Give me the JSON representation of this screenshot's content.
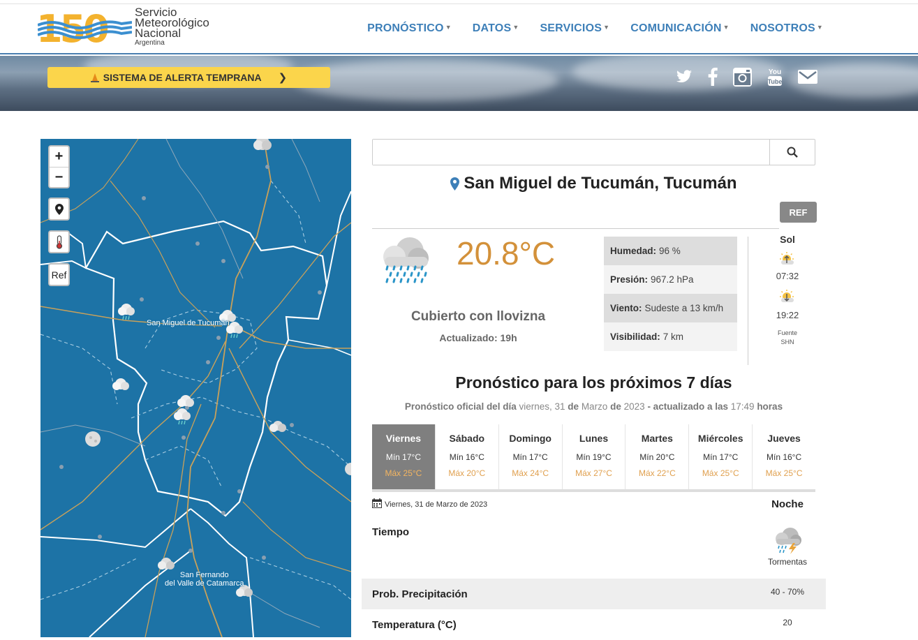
{
  "header": {
    "logo_number": "150",
    "logo_line1": "Servicio",
    "logo_line2": "Meteorológico",
    "logo_line3": "Nacional",
    "logo_line4": "Argentina",
    "nav": [
      "PRONÓSTICO",
      "DATOS",
      "SERVICIOS",
      "COMUNICACIÓN",
      "NOSOTROS"
    ]
  },
  "banner": {
    "alert_label": "SISTEMA DE ALERTA TEMPRANA",
    "social_icons": [
      "twitter-icon",
      "facebook-icon",
      "instagram-icon",
      "youtube-icon",
      "email-icon"
    ]
  },
  "map": {
    "zoom_in": "+",
    "zoom_out": "−",
    "ref_label": "Ref",
    "place_1": "San Miguel de Tucumán",
    "place_2_line1": "San Fernando",
    "place_2_line2": "del Valle de Catamarca"
  },
  "search": {
    "placeholder": ""
  },
  "current": {
    "city": "San Miguel de Tucumán, Tucumán",
    "ref_button": "REF",
    "temperature": "20.8°C",
    "condition": "Cubierto con llovizna",
    "updated": "Actualizado: 19h",
    "stats": [
      {
        "label": "Humedad:",
        "value": "96 %"
      },
      {
        "label": "Presión:",
        "value": "967.2 hPa"
      },
      {
        "label": "Viento:",
        "value": "Sudeste a 13 km/h"
      },
      {
        "label": "Visibilidad:",
        "value": "7 km"
      }
    ],
    "sun_title": "Sol",
    "sunrise": "07:32",
    "sunset": "19:22",
    "source_line1": "Fuente",
    "source_line2": "SHN"
  },
  "forecast": {
    "title": "Pronóstico para los próximos 7 días",
    "sub_a": "Pronóstico oficial del día",
    "sub_date": "viernes, 31",
    "sub_de1": "de",
    "sub_month": "Marzo",
    "sub_de2": "de",
    "sub_year": "2023",
    "sub_b": "- actualizado a las",
    "sub_time": "17:49",
    "sub_c": "horas",
    "days": [
      {
        "name": "Viernes",
        "min": "Mín 17°C",
        "max": "Máx 25°C"
      },
      {
        "name": "Sábado",
        "min": "Mín 16°C",
        "max": "Máx 20°C"
      },
      {
        "name": "Domingo",
        "min": "Mín 17°C",
        "max": "Máx 24°C"
      },
      {
        "name": "Lunes",
        "min": "Mín 19°C",
        "max": "Máx 27°C"
      },
      {
        "name": "Martes",
        "min": "Mín 20°C",
        "max": "Máx 22°C"
      },
      {
        "name": "Miércoles",
        "min": "Mín 17°C",
        "max": "Máx 25°C"
      },
      {
        "name": "Jueves",
        "min": "Mín 16°C",
        "max": "Máx 25°C"
      }
    ],
    "selected_date": "Viernes, 31 de Marzo de 2023",
    "period": "Noche",
    "tiempo_label": "Tiempo",
    "tiempo_value": "Tormentas",
    "precip_label": "Prob. Precipitación",
    "precip_value": "40 - 70%",
    "temp_label": "Temperatura (°C)",
    "temp_value": "20"
  },
  "colors": {
    "nav_blue": "#3d7fb8",
    "alert_yellow": "#fbd54b",
    "temp_orange": "#d3913a",
    "map_blue": "#1d73a6"
  }
}
